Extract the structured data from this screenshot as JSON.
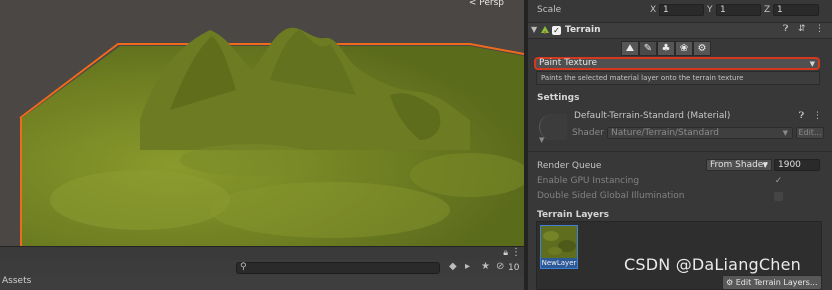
{
  "scene": {
    "view_label": "< Persp",
    "terrain_color": "#7d8d2a",
    "selection_outline_color": "#f06a1c"
  },
  "project": {
    "count_label": "10",
    "breadcrumb": "Assets",
    "icons": [
      "lock-icon",
      "menu-icon",
      "search-icon",
      "label-icon",
      "favorite-icon",
      "eye-icon"
    ]
  },
  "inspector": {
    "scale": {
      "label": "Scale",
      "x_label": "X",
      "x": "1",
      "y_label": "Y",
      "y": "1",
      "z_label": "Z",
      "z": "1"
    },
    "component": {
      "title": "Terrain",
      "enabled_mark": "✓",
      "icons": [
        "help-icon",
        "preset-icon",
        "kebab-menu-icon"
      ]
    },
    "tools": [
      "raise-terrain-tool",
      "paint-tool",
      "trees-tool",
      "details-tool",
      "settings-tool"
    ],
    "paint_mode": {
      "value": "Paint Texture",
      "description": "Paints the selected material layer onto the terrain texture"
    },
    "settings": {
      "heading": "Settings",
      "material_name": "Default-Terrain-Standard (Material)",
      "shader_label": "Shader",
      "shader_value": "Nature/Terrain/Standard",
      "edit_label": "Edit...",
      "render_queue_label": "Render Queue",
      "render_queue_mode": "From Shader",
      "render_queue_value": "1900",
      "gpu_instancing_label": "Enable GPU Instancing",
      "gpu_instancing_mark": "✓",
      "double_sided_label": "Double Sided Global Illumination"
    },
    "terrain_layers": {
      "heading": "Terrain Layers",
      "layers": [
        {
          "name": "NewLayer"
        }
      ],
      "edit_button": "Edit Terrain Layers..."
    }
  },
  "watermark": "CSDN @DaLiangChen"
}
